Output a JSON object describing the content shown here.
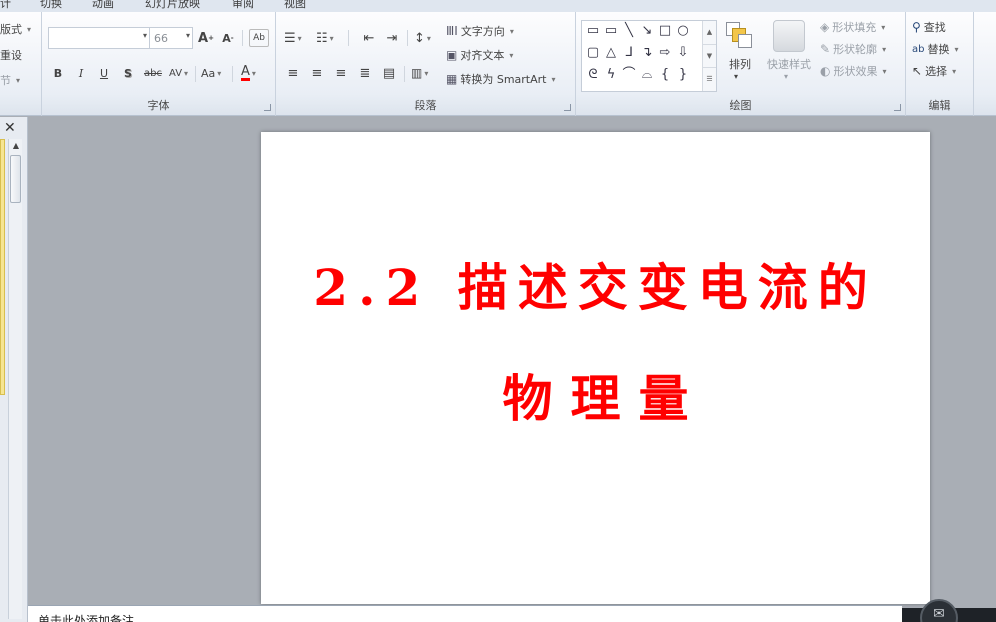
{
  "ribbon_tabs": [
    "计",
    "切换",
    "动画",
    "幻灯片放映",
    "审阅",
    "视图"
  ],
  "slides_group": {
    "layout": "版式",
    "reset": "重设",
    "section": "节"
  },
  "font_group": {
    "label": "字体",
    "font_name": "",
    "font_size": "66",
    "bold": "B",
    "italic": "I",
    "underline": "U",
    "shadow": "S",
    "strike": "abc",
    "spacing": "AV",
    "case": "Aa",
    "color": "A"
  },
  "paragraph_group": {
    "label": "段落",
    "text_direction": "文字方向",
    "align_text": "对齐文本",
    "smartart": "转换为 SmartArt"
  },
  "drawing_group": {
    "label": "绘图",
    "arrange": "排列",
    "quick_styles": "快速样式",
    "shape_fill": "形状填充",
    "shape_outline": "形状轮廓",
    "shape_effects": "形状效果"
  },
  "editing_group": {
    "label": "编辑",
    "find": "查找",
    "replace": "替换",
    "select": "选择"
  },
  "slide": {
    "title_line1": "2.2 描述交变电流的",
    "title_line2": "物理量"
  },
  "notes": {
    "placeholder": "单击此处添加备注"
  },
  "colors": {
    "title": "#ff0000",
    "workspace": "#a9aeb5"
  }
}
